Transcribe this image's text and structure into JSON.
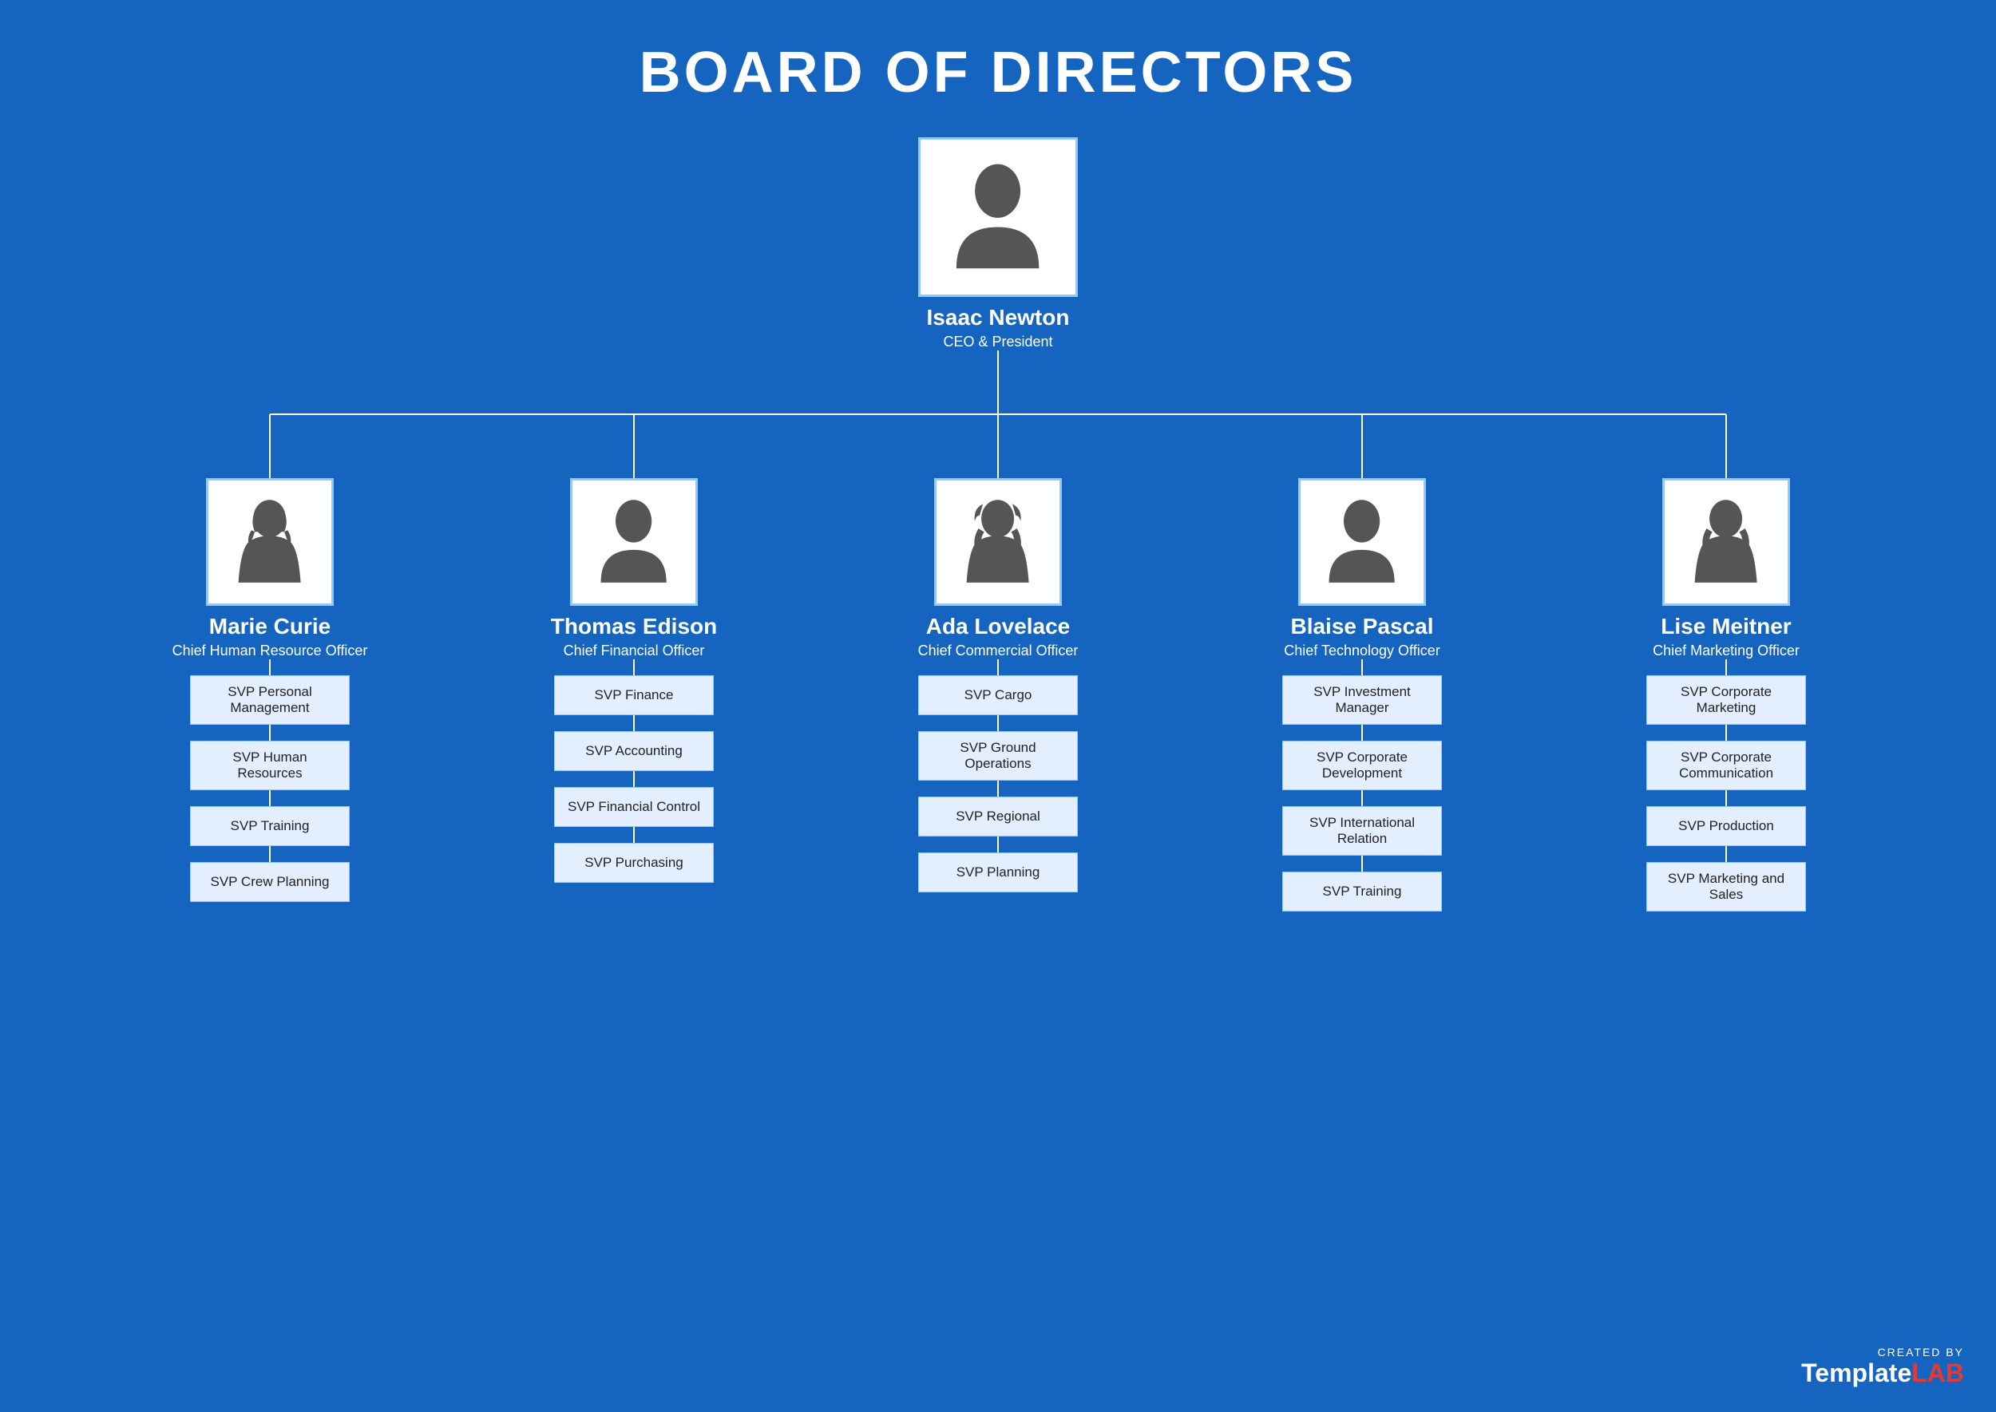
{
  "title": "BOARD OF DIRECTORS",
  "ceo": {
    "name": "Isaac Newton",
    "title": "CEO & President",
    "gender": "male"
  },
  "directors": [
    {
      "name": "Marie Curie",
      "title": "Chief Human Resource Officer",
      "gender": "female",
      "svps": [
        "SVP Personal Management",
        "SVP Human Resources",
        "SVP Training",
        "SVP Crew Planning"
      ]
    },
    {
      "name": "Thomas Edison",
      "title": "Chief Financial Officer",
      "gender": "male",
      "svps": [
        "SVP Finance",
        "SVP Accounting",
        "SVP Financial Control",
        "SVP Purchasing"
      ]
    },
    {
      "name": "Ada Lovelace",
      "title": "Chief Commercial Officer",
      "gender": "female",
      "svps": [
        "SVP Cargo",
        "SVP Ground Operations",
        "SVP Regional",
        "SVP Planning"
      ]
    },
    {
      "name": "Blaise Pascal",
      "title": "Chief Technology Officer",
      "gender": "male",
      "svps": [
        "SVP Investment Manager",
        "SVP Corporate Development",
        "SVP International Relation",
        "SVP Training"
      ]
    },
    {
      "name": "Lise Meitner",
      "title": "Chief Marketing Officer",
      "gender": "female",
      "svps": [
        "SVP Corporate Marketing",
        "SVP Corporate Communication",
        "SVP Production",
        "SVP Marketing and Sales"
      ]
    }
  ],
  "watermark": {
    "created_by": "CREATED BY",
    "brand": "Template",
    "brand_accent": "LAB"
  }
}
